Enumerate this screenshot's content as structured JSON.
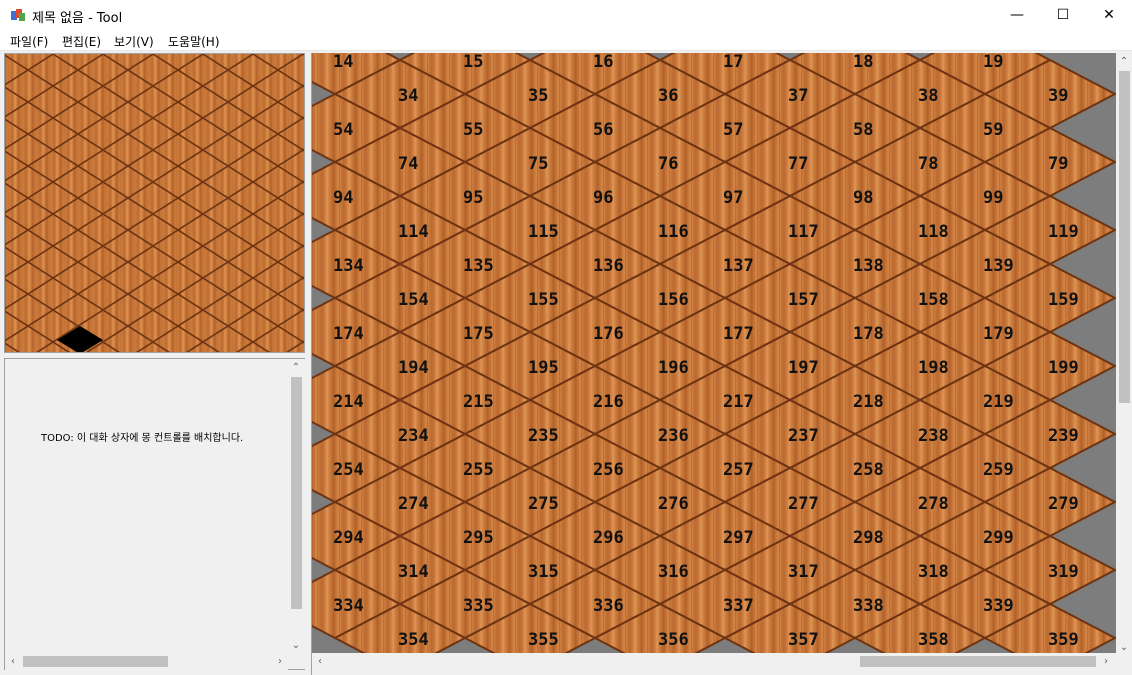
{
  "window": {
    "title": "제목 없음 - Tool",
    "minimize_glyph": "—",
    "maximize_glyph": "☐",
    "close_glyph": "✕"
  },
  "menu": [
    {
      "label": "파일(F)"
    },
    {
      "label": "편집(E)"
    },
    {
      "label": "보기(V)"
    },
    {
      "label": "도움말(H)"
    }
  ],
  "dialog": {
    "todo_text": "TODO: 이 대화 상자에 몽 컨트롤를 배치합니다."
  },
  "tile_labels": [
    [
      "14",
      "15",
      "16",
      "17",
      "18",
      "19"
    ],
    [
      "34",
      "35",
      "36",
      "37",
      "38",
      "39"
    ],
    [
      "54",
      "55",
      "56",
      "57",
      "58",
      "59"
    ],
    [
      "74",
      "75",
      "76",
      "77",
      "78",
      "79"
    ],
    [
      "94",
      "95",
      "96",
      "97",
      "98",
      "99"
    ],
    [
      "114",
      "115",
      "116",
      "117",
      "118",
      "119"
    ],
    [
      "134",
      "135",
      "136",
      "137",
      "138",
      "139"
    ],
    [
      "154",
      "155",
      "156",
      "157",
      "158",
      "159"
    ],
    [
      "174",
      "175",
      "176",
      "177",
      "178",
      "179"
    ],
    [
      "194",
      "195",
      "196",
      "197",
      "198",
      "199"
    ],
    [
      "214",
      "215",
      "216",
      "217",
      "218",
      "219"
    ],
    [
      "234",
      "235",
      "236",
      "237",
      "238",
      "239"
    ],
    [
      "254",
      "255",
      "256",
      "257",
      "258",
      "259"
    ],
    [
      "274",
      "275",
      "276",
      "277",
      "278",
      "279"
    ],
    [
      "294",
      "295",
      "296",
      "297",
      "298",
      "299"
    ],
    [
      "314",
      "315",
      "316",
      "317",
      "318",
      "319"
    ],
    [
      "334",
      "335",
      "336",
      "337",
      "338",
      "339"
    ],
    [
      "354",
      "355",
      "356",
      "357",
      "358",
      "359"
    ]
  ],
  "colors": {
    "wood_light": "#c97838",
    "wood_dark": "#9a5024",
    "grout": "#6e3412",
    "backdrop_gray": "#7d7d7d",
    "cursor_tile": "#000000"
  },
  "icons": {
    "app": "app-icon",
    "scroll_up": "chevron-up-icon",
    "scroll_down": "chevron-down-icon",
    "scroll_left": "chevron-left-icon",
    "scroll_right": "chevron-right-icon"
  }
}
